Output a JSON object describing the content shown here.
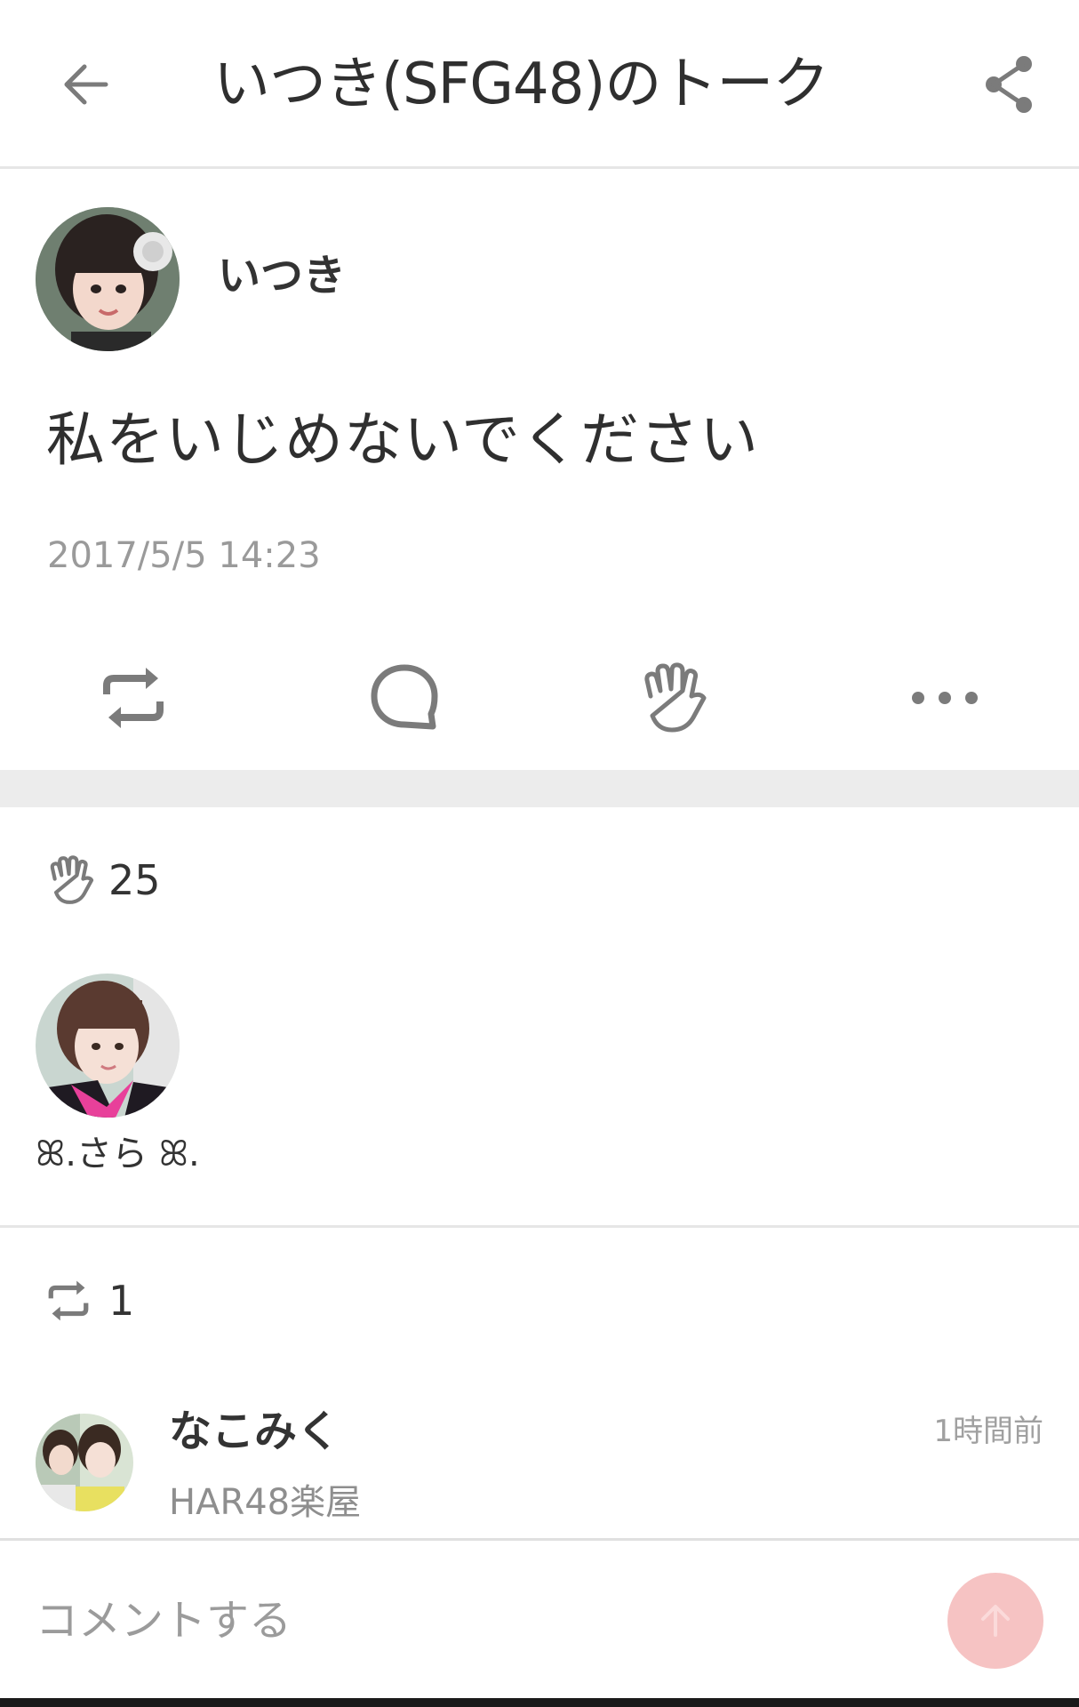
{
  "header": {
    "back_icon": "arrow-left-icon",
    "title": "いつき(SFG48)のトーク",
    "share_icon": "share-icon"
  },
  "post": {
    "author_name": "いつき",
    "body": "私をいじめないでください",
    "timestamp": "2017/5/5 14:23",
    "actions": [
      {
        "icon": "repost-icon"
      },
      {
        "icon": "comment-icon"
      },
      {
        "icon": "clap-icon"
      },
      {
        "icon": "more-icon"
      }
    ]
  },
  "likes": {
    "icon": "clap-icon",
    "count": "25",
    "users": [
      {
        "name": "ꕤ.さら ꕤ."
      }
    ]
  },
  "reposts": {
    "icon": "repost-icon",
    "count": "1",
    "items": [
      {
        "name": "なこみく",
        "group": "HAR48楽屋",
        "time": "1時間前"
      }
    ]
  },
  "comment": {
    "placeholder": "コメントする",
    "send_icon": "arrow-up-icon"
  },
  "colors": {
    "accent_send": "#f6c3c3",
    "icon_gray": "#7b7b7b",
    "divider": "#ececec"
  }
}
